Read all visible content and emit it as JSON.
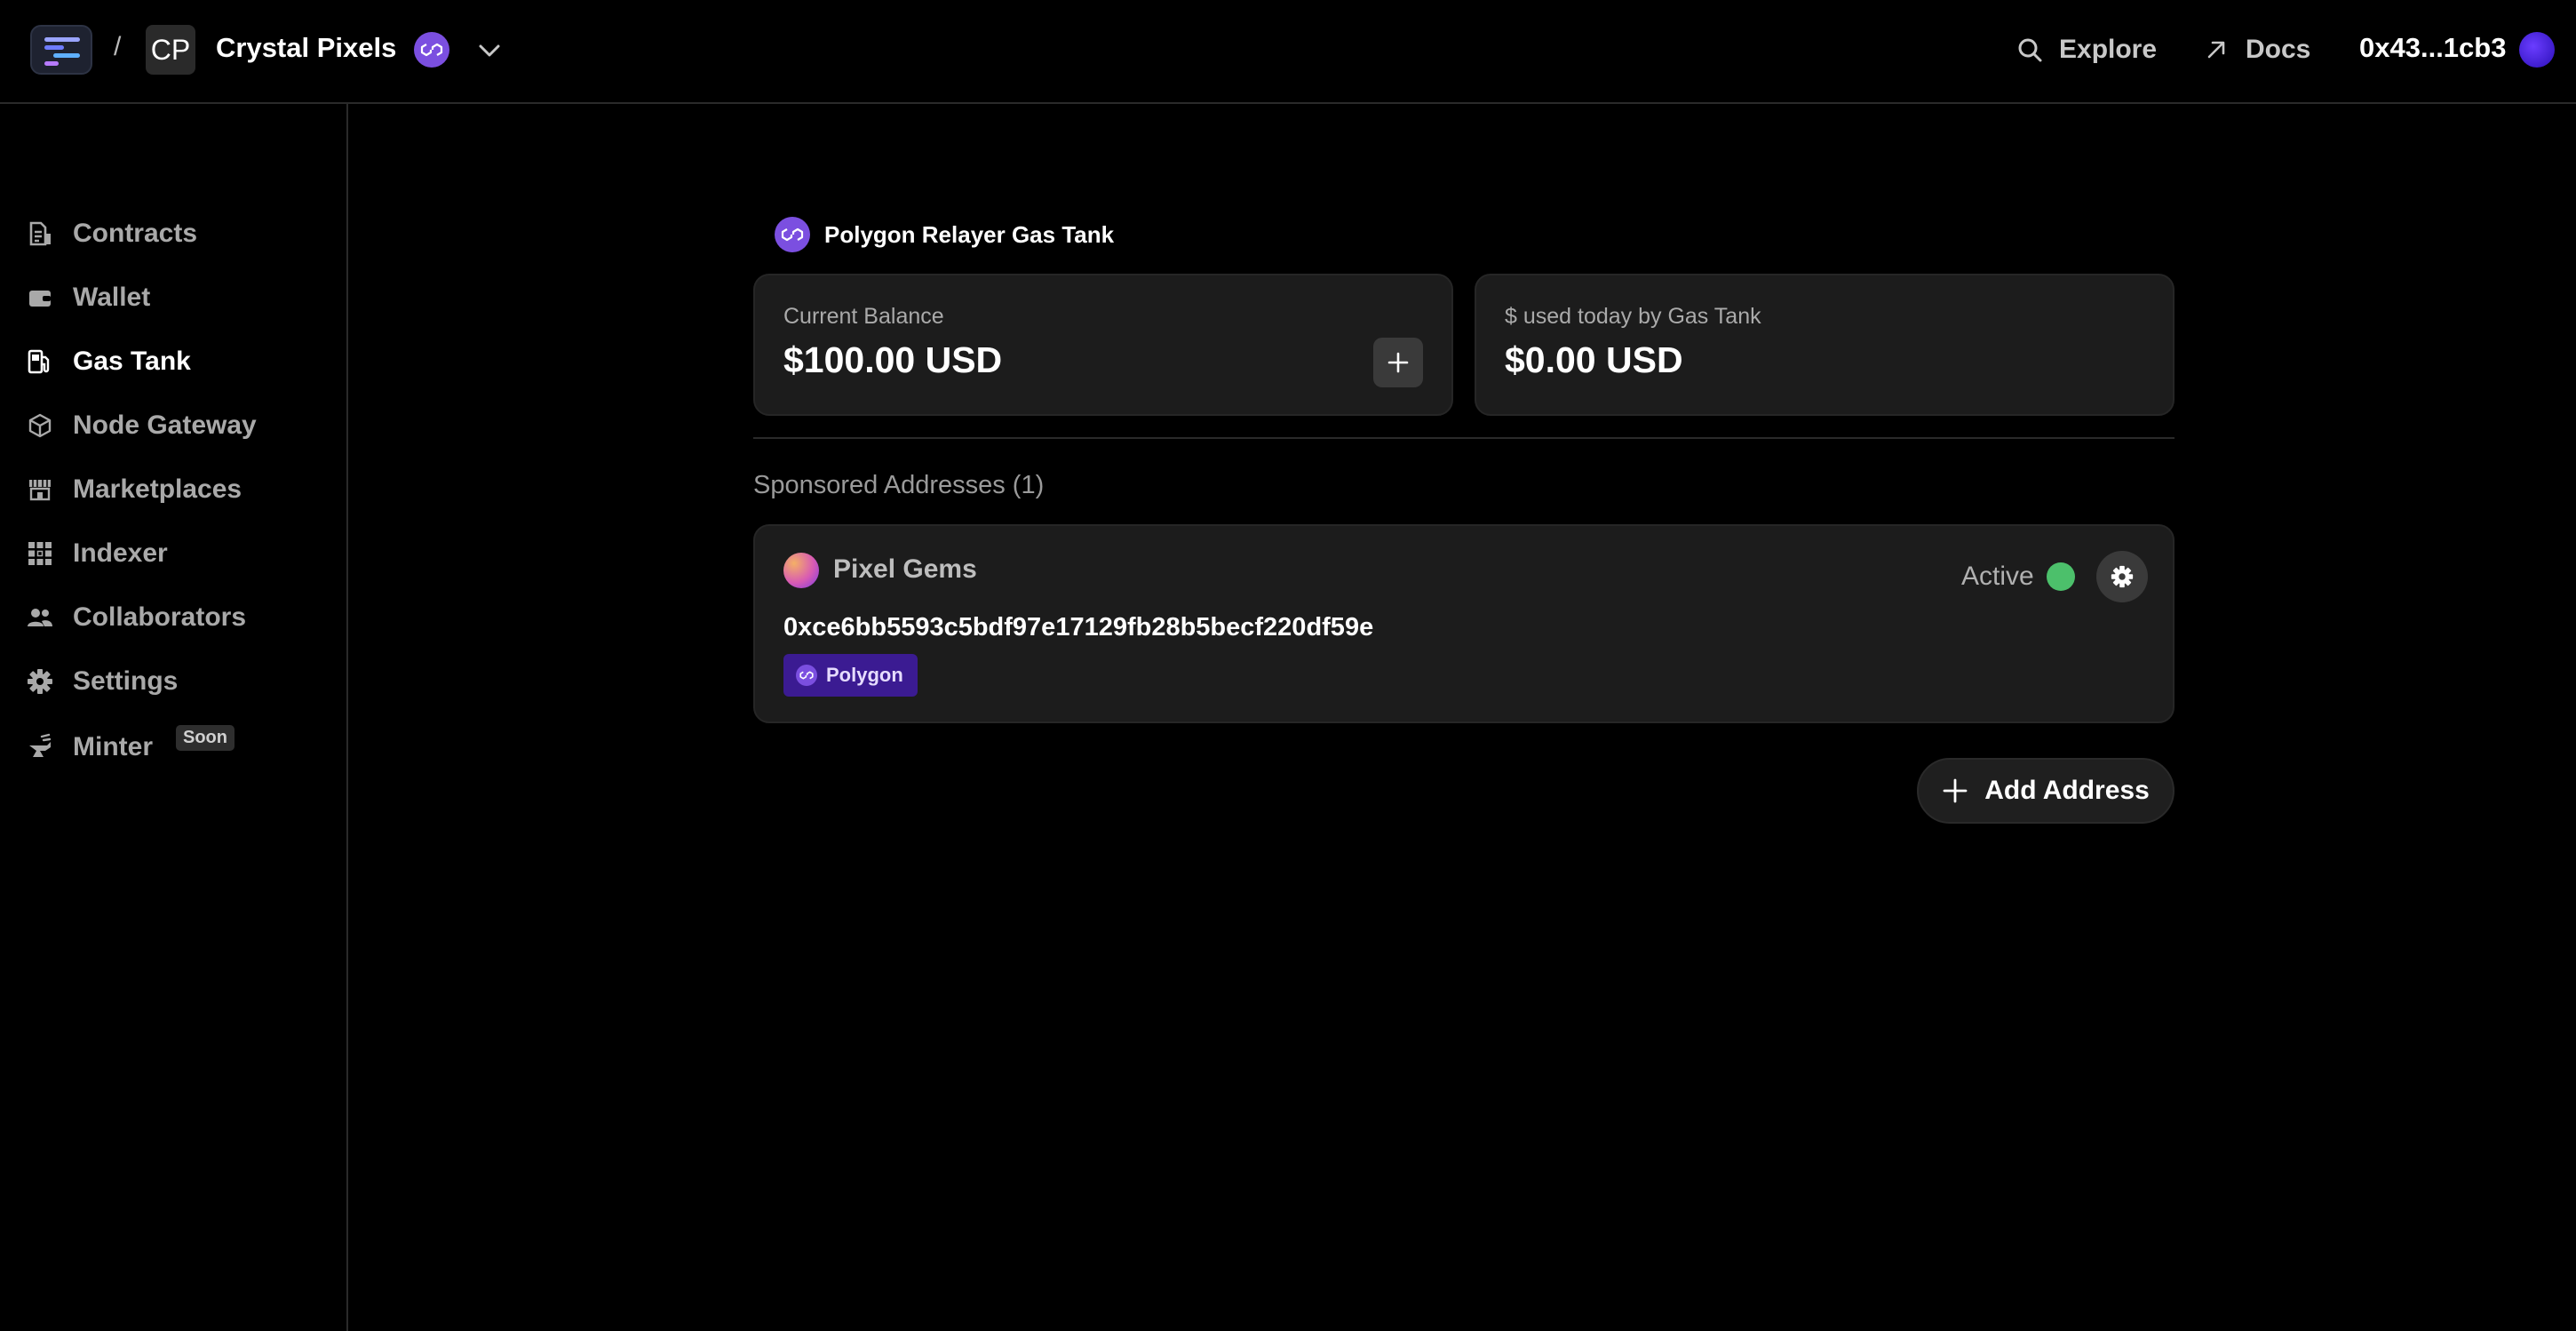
{
  "header": {
    "breadcrumb_separator": "/",
    "project_initials": "CP",
    "project_name": "Crystal Pixels",
    "nav": {
      "explore": "Explore",
      "docs": "Docs"
    },
    "wallet_address": "0x43...1cb3"
  },
  "sidebar": {
    "items": [
      {
        "label": "Contracts",
        "icon": "contracts-icon",
        "active": false
      },
      {
        "label": "Wallet",
        "icon": "wallet-icon",
        "active": false
      },
      {
        "label": "Gas Tank",
        "icon": "gas-pump-icon",
        "active": true
      },
      {
        "label": "Node Gateway",
        "icon": "cube-icon",
        "active": false
      },
      {
        "label": "Marketplaces",
        "icon": "storefront-icon",
        "active": false
      },
      {
        "label": "Indexer",
        "icon": "grid-icon",
        "active": false
      },
      {
        "label": "Collaborators",
        "icon": "users-icon",
        "active": false
      },
      {
        "label": "Settings",
        "icon": "gear-icon",
        "active": false
      },
      {
        "label": "Minter",
        "icon": "anvil-icon",
        "active": false,
        "badge": "Soon"
      }
    ]
  },
  "main": {
    "tank_title": "Polygon Relayer Gas Tank",
    "balance_card": {
      "label": "Current Balance",
      "value": "$100.00 USD"
    },
    "usage_card": {
      "label": "$ used today by Gas Tank",
      "value": "$0.00 USD"
    },
    "sponsored_heading": "Sponsored Addresses (1)",
    "addresses": [
      {
        "name": "Pixel Gems",
        "address": "0xce6bb5593c5bdf97e17129fb28b5becf220df59e",
        "chain": "Polygon",
        "status": "Active"
      }
    ],
    "add_address_label": "Add Address"
  },
  "colors": {
    "background": "#000000",
    "card": "#1c1c1c",
    "polygon_purple": "#7b4fe0",
    "active_green": "#4cc06b",
    "chain_tag_bg": "#3b1b92"
  }
}
